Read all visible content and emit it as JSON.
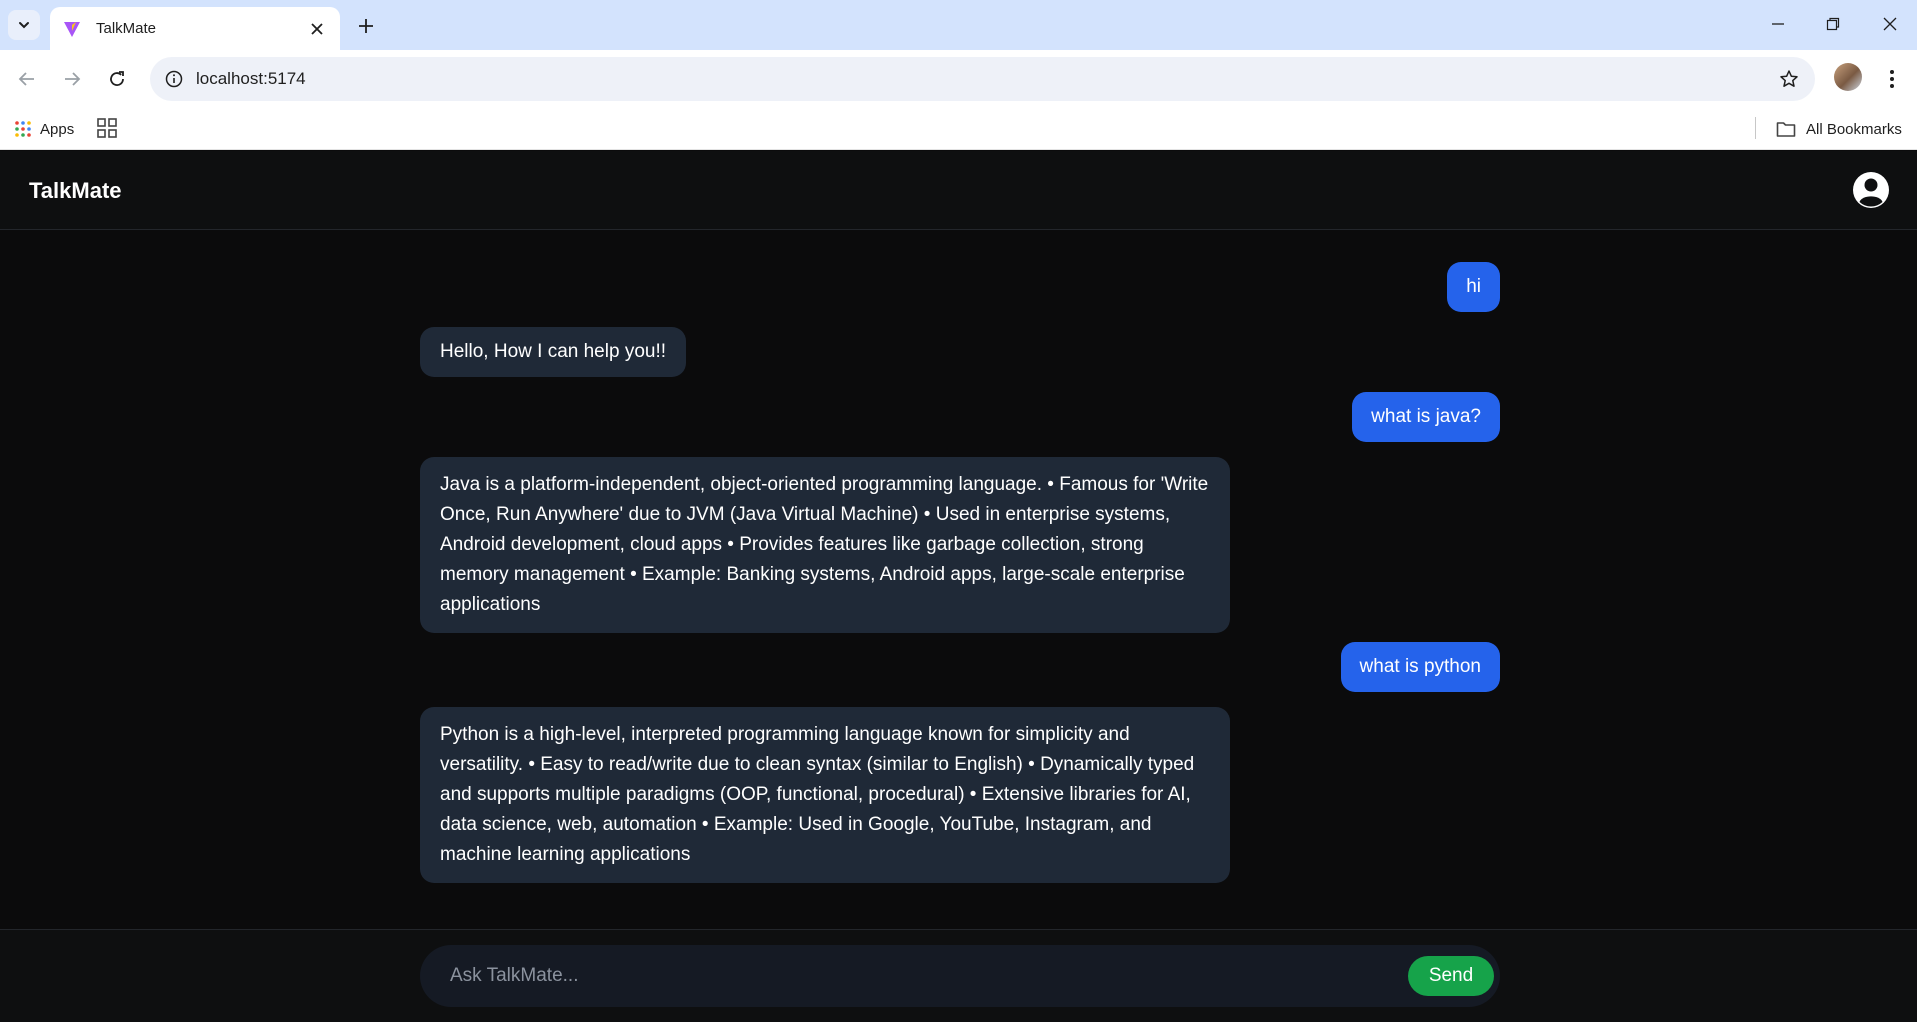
{
  "browser": {
    "tab_title": "TalkMate",
    "url": "localhost:5174",
    "bookmarks": {
      "apps_label": "Apps",
      "all_bookmarks_label": "All Bookmarks"
    }
  },
  "app": {
    "brand": "TalkMate",
    "messages": [
      {
        "role": "user",
        "text": "hi"
      },
      {
        "role": "bot",
        "text": "Hello, How I can help you!!"
      },
      {
        "role": "user",
        "text": "what is java?"
      },
      {
        "role": "bot",
        "text": "Java is a platform-independent, object-oriented programming language. • Famous for 'Write Once, Run Anywhere' due to JVM (Java Virtual Machine) • Used in enterprise systems, Android development, cloud apps • Provides features like garbage collection, strong memory management • Example: Banking systems, Android apps, large-scale enterprise applications"
      },
      {
        "role": "user",
        "text": "what is python"
      },
      {
        "role": "bot",
        "text": "Python is a high-level, interpreted programming language known for simplicity and versatility. • Easy to read/write due to clean syntax (similar to English) • Dynamically typed and supports multiple paradigms (OOP, functional, procedural) • Extensive libraries for AI, data science, web, automation • Example: Used in Google, YouTube, Instagram, and machine learning applications"
      }
    ],
    "composer": {
      "placeholder": "Ask TalkMate...",
      "value": "",
      "send_label": "Send"
    }
  },
  "colors": {
    "user_bubble": "#2563eb",
    "bot_bubble": "#1f2937",
    "send_button": "#16a34a",
    "app_background": "#0b0b0c"
  },
  "icons": [
    "tab-search-icon",
    "favicon-icon",
    "close-icon",
    "plus-icon",
    "minimize-icon",
    "restore-icon",
    "back-icon",
    "forward-icon",
    "reload-icon",
    "site-info-icon",
    "star-icon",
    "kebab-menu-icon",
    "apps-grid-icon",
    "tab-groups-icon",
    "folder-icon",
    "user-circle-icon"
  ]
}
